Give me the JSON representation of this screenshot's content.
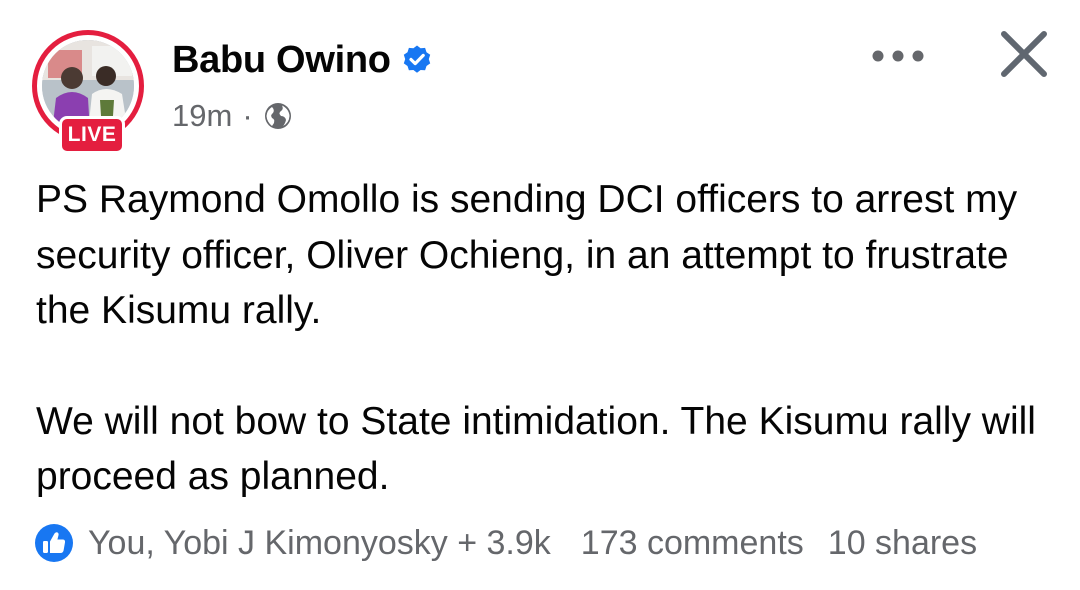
{
  "post": {
    "author": {
      "name": "Babu Owino",
      "verified": true,
      "live_badge": "LIVE",
      "avatar": "profile-photo"
    },
    "meta": {
      "time": "19m",
      "separator": "·",
      "audience_icon": "globe-icon"
    },
    "actions": {
      "more_icon": "more-icon",
      "close_icon": "close-icon"
    },
    "body": {
      "paragraphs": [
        "PS Raymond Omollo is sending DCI officers to arrest my security officer, Oliver Ochieng, in an attempt to frustrate the Kisumu rally.",
        "We will not bow to State intimidation. The Kisumu rally will proceed as planned."
      ]
    },
    "footer": {
      "reaction_icon": "like-icon",
      "reactions": "You, Yobi J Kimonyosky + 3.9k",
      "comments": "173 comments",
      "shares": "10 shares"
    }
  },
  "colors": {
    "live_red": "#e41e3f",
    "verified_blue": "#1877f2",
    "secondary_text": "#65676b",
    "primary_text": "#050505"
  }
}
